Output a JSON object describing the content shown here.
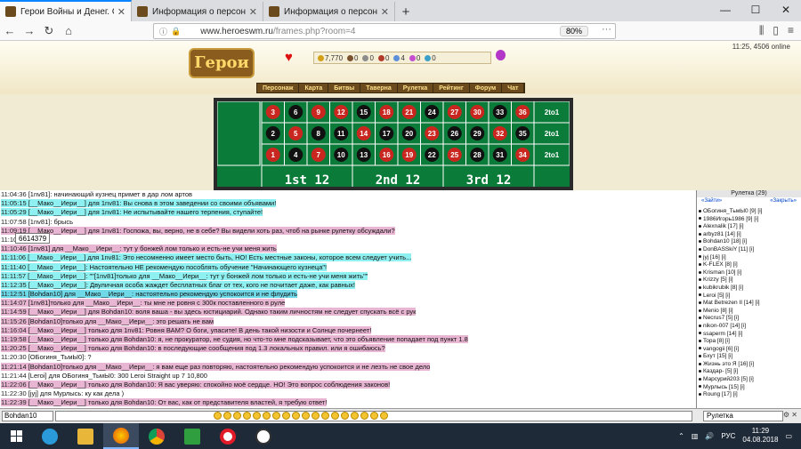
{
  "tabs": [
    {
      "title": "Герои Войны и Денег. Онлайн",
      "active": true
    },
    {
      "title": "Информация о персонаже.",
      "active": false
    },
    {
      "title": "Информация о персонаже.",
      "active": false
    }
  ],
  "nav": {
    "url_host": "www.heroeswm.ru",
    "url_path": "/frames.php?room=4",
    "zoom": "80%"
  },
  "game": {
    "online": "11:25, 4506 online",
    "logo": "Герои",
    "resources": [
      "7,770",
      "0",
      "0",
      "0",
      "4",
      "0",
      "0"
    ],
    "menu": [
      "Персонаж",
      "Карта",
      "Битвы",
      "Таверна",
      "Рулетка",
      "Рейтинг",
      "Форум",
      "Чат"
    ],
    "roulette": {
      "rows": [
        [
          {
            "n": "3",
            "c": "r"
          },
          {
            "n": "6",
            "c": "b"
          },
          {
            "n": "9",
            "c": "r"
          },
          {
            "n": "12",
            "c": "r"
          },
          {
            "n": "15",
            "c": "b"
          },
          {
            "n": "18",
            "c": "r"
          },
          {
            "n": "21",
            "c": "r"
          },
          {
            "n": "24",
            "c": "b"
          },
          {
            "n": "27",
            "c": "r"
          },
          {
            "n": "30",
            "c": "r"
          },
          {
            "n": "33",
            "c": "b"
          },
          {
            "n": "36",
            "c": "r"
          }
        ],
        [
          {
            "n": "2",
            "c": "b"
          },
          {
            "n": "5",
            "c": "r"
          },
          {
            "n": "8",
            "c": "b"
          },
          {
            "n": "11",
            "c": "b"
          },
          {
            "n": "14",
            "c": "r"
          },
          {
            "n": "17",
            "c": "b"
          },
          {
            "n": "20",
            "c": "b"
          },
          {
            "n": "23",
            "c": "r"
          },
          {
            "n": "26",
            "c": "b"
          },
          {
            "n": "29",
            "c": "b"
          },
          {
            "n": "32",
            "c": "r"
          },
          {
            "n": "35",
            "c": "b"
          }
        ],
        [
          {
            "n": "1",
            "c": "r"
          },
          {
            "n": "4",
            "c": "b"
          },
          {
            "n": "7",
            "c": "r"
          },
          {
            "n": "10",
            "c": "b"
          },
          {
            "n": "13",
            "c": "b"
          },
          {
            "n": "16",
            "c": "r"
          },
          {
            "n": "19",
            "c": "r"
          },
          {
            "n": "22",
            "c": "b"
          },
          {
            "n": "25",
            "c": "r"
          },
          {
            "n": "28",
            "c": "b"
          },
          {
            "n": "31",
            "c": "b"
          },
          {
            "n": "34",
            "c": "r"
          }
        ]
      ],
      "col_bet": "2to1",
      "dozens": [
        "1st 12",
        "2nd 12",
        "3rd 12"
      ]
    }
  },
  "chat": [
    {
      "t": "11:04:36",
      "text": " [1nv81]: начинающий кузнец примет в дар лом артов",
      "hl": ""
    },
    {
      "t": "11:05:15",
      "text": " [__Мако__Иери__] для 1nv81: Вы снова в этом заведении со своими объявами!",
      "hl": "hl-a"
    },
    {
      "t": "11:05:29",
      "text": " [__Мако__Иери__] для 1nv81: Не испытывайте нашего терпения, ступайте!",
      "hl": "hl-a"
    },
    {
      "t": "11:07:58",
      "text": " [1nv81]: брысь",
      "hl": ""
    },
    {
      "t": "11:09:19",
      "text": " [__Мако__Иери__] для 1nv81: Госпожа, вы, верно, не в себе? Вы видели хоть раз, чтоб на рынке рулетку обсуждали?",
      "hl": "hl-p"
    },
    {
      "t": "11:10:",
      "text": "            erm]: 30",
      "hl": ""
    },
    {
      "t": "11:10:46",
      "text": " [1nv81] для __Мако__Иери__: тут у бонжей лом только и есть-не учи меня жить",
      "hl": "hl-p"
    },
    {
      "t": "11:11:06",
      "text": " [__Мако__Иери__] для 1nv81: Это несомненно имеет место быть, НО! Есть местные законы, которое всем следует учить...",
      "hl": "hl-a"
    },
    {
      "t": "11:11:40",
      "text": " [__Мако__Иери__]: Настоятельно НЕ рекомендую пособлять обучение \"Начинающего кузнеца\"!",
      "hl": "hl-a"
    },
    {
      "t": "11:11:57",
      "text": " [__Мако__Иери__]: \"\"[1nv81]только для __Мако__Иери__: тут у бонжей лом только и есть-не учи меня жить\"\"",
      "hl": "hl-a"
    },
    {
      "t": "11:12:35",
      "text": " [__Мако__Иери__]: Двуличная особа жаждет бесплатных благ от тех, кого не почитает даже, как равных!",
      "hl": "hl-a"
    },
    {
      "t": "11:12:51",
      "text": " [Bohdan10] для __Мако__Иери__: настоятельно рекомендую успокоится и не флудить",
      "hl": "hl-b"
    },
    {
      "t": "11:14:07",
      "text": " [1nv81]только для __Мако__Иери__: ты мне не ровня с 300к поставленного в руле",
      "hl": "hl-p"
    },
    {
      "t": "11:14:59",
      "text": " [__Мако__Иери__] для Bohdan10: воля ваша - вы здесь юстициарий. Однако таким личностям не следует спускать всё с рук",
      "hl": "hl-p"
    },
    {
      "t": "11:15:26",
      "text": " [Bohdan10]только для __Мако__Иери__: это решать не вам",
      "hl": "hl-p"
    },
    {
      "t": "11:16:04",
      "text": " [__Мако__Иери__] только для 1nv81: Ровня ВАМ? О боги, упасите! В день такой низости и Солнце почернеет!",
      "hl": "hl-p"
    },
    {
      "t": "11:19:58",
      "text": " [__Мако__Иери__] только для Bohdan10: я, не прокуратор, не судия, но что-то мне подсказывает, что это объявление попадает под пункт 1.8",
      "hl": "hl-p"
    },
    {
      "t": "11:20:25",
      "text": " [__Мако__Иери__] только для Bohdan10: в последующие сообщения под 1.3 локальных правил. или я ошибаюсь?",
      "hl": "hl-p"
    },
    {
      "t": "11:20:30",
      "text": " [ОБогиня_ТьмЫ0]: ?",
      "hl": ""
    },
    {
      "t": "11:21:14",
      "text": " [Bohdan10]только для __Мако__Иери__: я вам еще раз повторяю, настоятельно рекомендую успокоится и не лезть не свое дело",
      "hl": "hl-p"
    },
    {
      "t": "11:21:44",
      "text": " [Leroi] для ОБогиня_ТьмЫ0: 300 Leroi Straight up 7 10,800",
      "hl": ""
    },
    {
      "t": "11:22:06",
      "text": " [__Мако__Иери__] только для Bohdan10: Я вас уверяю: спокойно моё сердце. НО! Это вопрос соблюдения законов!",
      "hl": "hl-p"
    },
    {
      "t": "11:22:30",
      "text": " [jyj] для Мурлысь: ку как дела )",
      "hl": ""
    },
    {
      "t": "11:22:39",
      "text": " [__Мако__Иери__] только для Bohdan10: От вас, как от представителя властей, я требую ответ!",
      "hl": "hl-p"
    },
    {
      "t": "11:22:42",
      "text": " [jyj]:",
      "hl": ""
    },
    {
      "t": "11:23:01",
      "text": " [ОБогиня_ТьмЫ0] для ОБогиня_ТьмЫ0: Хорош)",
      "hl": ""
    },
    {
      "t": "11:23:51",
      "text": " [Мурлысь] для jyj: отлично )) а ты как поживаешь заблудшая душа ?))",
      "hl": ""
    },
    {
      "t": "11:24:38",
      "text": " [jyj]: вашими молитвами тока и живу",
      "hl": ""
    }
  ],
  "tooltip": "6614379",
  "players": {
    "title": "Рулетка (29)",
    "join": "«Зайти»",
    "close": "«Закрыть»",
    "list": [
      "ОБогиня_ТьмЫ0 [9] [i]",
      "1986Игорь1986 [9] [i]",
      "Alexnalik [17] [i]",
      "arbyz81 [14] [i]",
      "Bohdan10 [18] [i]",
      "DonBASSkiY [11] [i]",
      "jyj [16] [i]",
      "K-FLEX [8] [i]",
      "Krisman [10] [i]",
      "Krizzy [5] [i]",
      "kubikrubik [8] [i]",
      "Leroi [5] [i]",
      "Mat Betrezen II [14] [i]",
      "Menio [8] [i]",
      "Necrus7 [5] [i]",
      "nikon-007 [14] [i]",
      "ssaperm [14] [i]",
      "Topa [8] [i]",
      "vangogii [6] [i]",
      "Бхут [15] [i]",
      "Жизнь это Я [16] [i]",
      "Каздар- [5] [i]",
      "Марсурий203 [5] [i]",
      "Мурлысь [15] [i]",
      "Roung [17] [i]"
    ]
  },
  "input": {
    "name": "Bohdan10",
    "room": "Рулетка"
  },
  "taskbar": {
    "lang": "РУС",
    "time": "11:29",
    "date": "04.08.2018"
  },
  "colors": {
    "red_cell": "#c8261f",
    "black_cell": "#111111",
    "felt": "#0b7b3a"
  }
}
